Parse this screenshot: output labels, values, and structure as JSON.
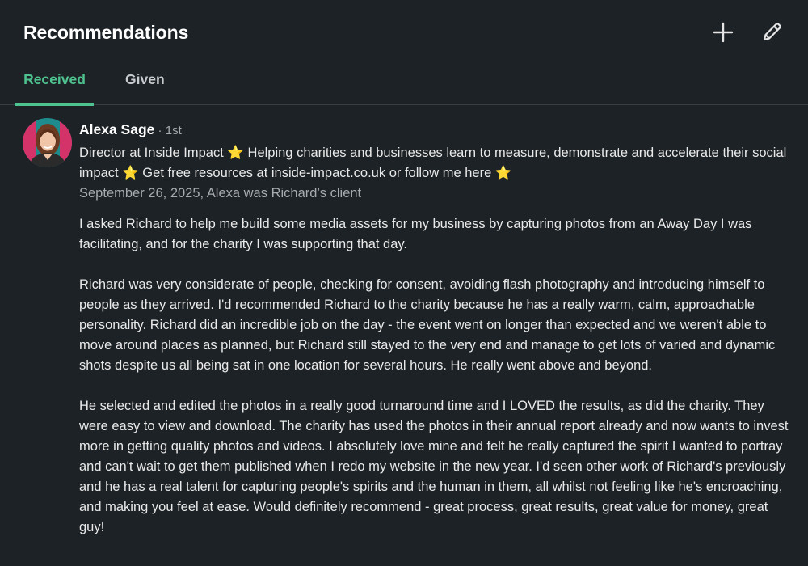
{
  "header": {
    "title": "Recommendations",
    "add_icon": "plus-icon",
    "edit_icon": "pencil-icon"
  },
  "tabs": [
    {
      "label": "Received",
      "active": true
    },
    {
      "label": "Given",
      "active": false
    }
  ],
  "colors": {
    "background": "#1d2226",
    "accent": "#4fc38f",
    "text": "#e9e9e9",
    "muted": "#a7abae"
  },
  "recommendation": {
    "name": "Alexa Sage",
    "degree": " · 1st",
    "headline": "Director at Inside Impact ⭐ Helping charities and businesses learn to measure, demonstrate and accelerate their social impact ⭐ Get free resources at inside-impact.co.uk or follow me here ⭐",
    "meta": "September 26, 2025, Alexa was Richard’s client",
    "paragraphs": [
      "I asked Richard to help me build some media assets for my business by capturing photos from an Away Day I was facilitating, and for the charity I was supporting that day.",
      "Richard was very considerate of people, checking for consent, avoiding flash photography and introducing himself to people as they arrived. I'd recommended Richard to the charity because he has a really warm, calm, approachable personality. Richard did an incredible job on the day - the event went on longer than expected and we weren't able to move around places as planned, but Richard still stayed to the very end and manage to get lots of varied and dynamic shots despite us all being sat in one location for several hours. He really went above and beyond.",
      "He selected and edited the photos in a really good turnaround time and I LOVED the results, as did the charity. They were easy to view and download. The charity has used the photos in their annual report already and now wants to invest more in getting quality photos and videos. I absolutely love mine and felt he really captured the spirit I wanted to portray and can't wait to get them published when I redo my website in the new year. I'd seen other work of Richard's previously and he has a real talent for capturing people's spirits and the human in them, all whilst not feeling like he's encroaching, and making you feel at ease. Would definitely recommend - great process, great results, great value for money, great guy!"
    ]
  }
}
